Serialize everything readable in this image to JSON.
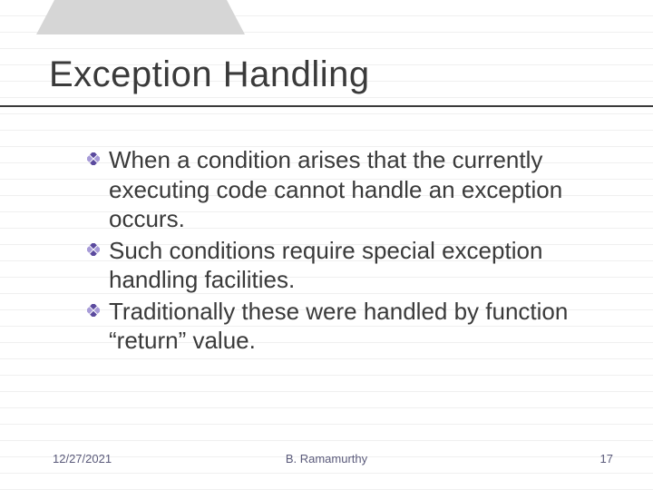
{
  "slide": {
    "title": "Exception Handling",
    "bullets": [
      "When a condition arises that the currently executing code cannot handle an exception occurs.",
      "Such conditions require special exception handling facilities.",
      "Traditionally these were handled by function “return” value."
    ]
  },
  "footer": {
    "date": "12/27/2021",
    "author": "B. Ramamurthy",
    "page": "17"
  },
  "icons": {
    "bullet": "diamond-grid-icon"
  },
  "colors": {
    "text": "#3a3a3a",
    "footer": "#5a5a7a",
    "bulletA": "#5b4a9e",
    "bulletB": "#a79bd8",
    "tab": "#d6d6d6"
  }
}
